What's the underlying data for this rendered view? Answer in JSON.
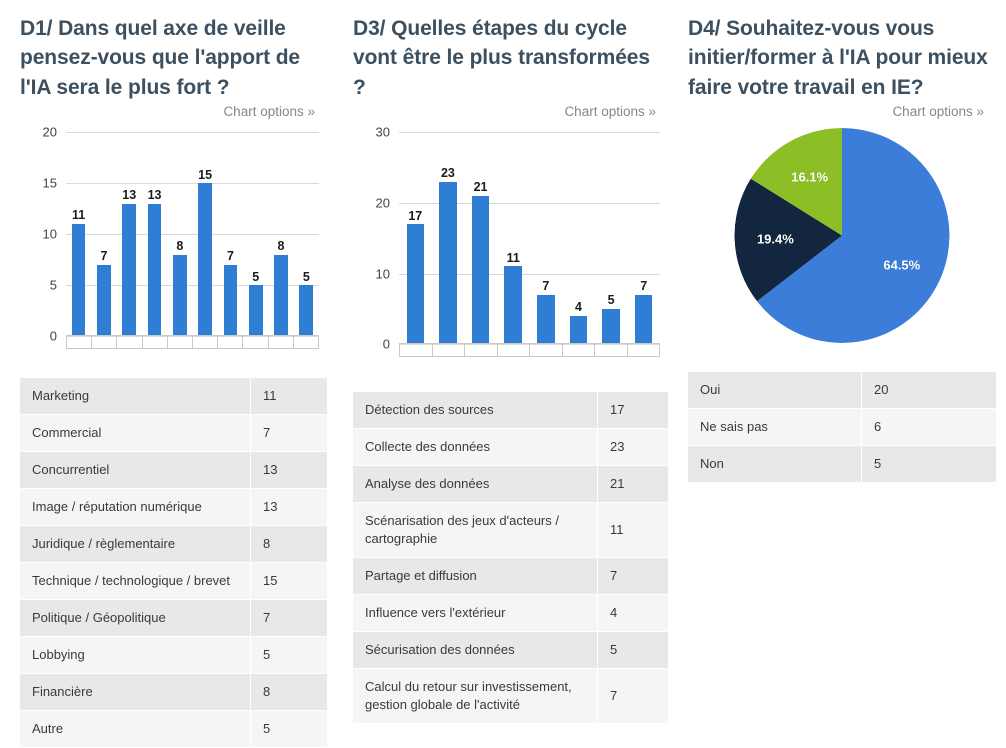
{
  "panels": [
    {
      "id": "d1",
      "title": "D1/ Dans quel axe de veille pensez-vous que l'apport de l'IA sera le plus fort ?",
      "chart_options_label": "Chart options »"
    },
    {
      "id": "d3",
      "title": "D3/ Quelles étapes du cycle vont être le plus transformées ?",
      "chart_options_label": "Chart options »"
    },
    {
      "id": "d4",
      "title": "D4/ Souhaitez-vous vous initier/former à l'IA pour mieux faire votre travail en IE?",
      "chart_options_label": "Chart options »"
    }
  ],
  "colors": {
    "bar_blue": "#2e7fd4",
    "pie_blue": "#3b7dd8",
    "pie_navy": "#12263f",
    "pie_green": "#8cbf26",
    "title": "#3d5060",
    "gridline": "#d9d9d9",
    "table_row_odd": "#e8e8e8",
    "table_row_even": "#f5f5f5"
  },
  "chart_data": [
    {
      "type": "bar",
      "id": "d1-chart",
      "title": "D1/ Dans quel axe de veille pensez-vous que l'apport de l'IA sera le plus fort ?",
      "xlabel": "",
      "ylabel": "",
      "ylim": [
        0,
        20
      ],
      "yticks": [
        0,
        5,
        10,
        15,
        20
      ],
      "grid": true,
      "legend": "none",
      "categories": [
        "Marketing",
        "Commercial",
        "Concurrentiel",
        "Image / réputation numérique",
        "Juridique / règlementaire",
        "Technique / technologique / brevet",
        "Politique / Géopolitique",
        "Lobbying",
        "Financière",
        "Autre"
      ],
      "values": [
        11,
        7,
        13,
        13,
        8,
        15,
        7,
        5,
        8,
        5
      ]
    },
    {
      "type": "bar",
      "id": "d3-chart",
      "title": "D3/ Quelles étapes du cycle vont être le plus transformées ?",
      "xlabel": "",
      "ylabel": "",
      "ylim": [
        0,
        30
      ],
      "yticks": [
        0,
        10,
        20,
        30
      ],
      "grid": true,
      "legend": "none",
      "categories": [
        "Détection des sources",
        "Collecte des données",
        "Analyse des données",
        "Scénarisation des jeux d'acteurs / cartographie",
        "Partage et diffusion",
        "Influence vers l'extérieur",
        "Sécurisation des données",
        "Calcul du retour sur investissement, gestion globale de l'activité"
      ],
      "values": [
        17,
        23,
        21,
        11,
        7,
        4,
        5,
        7
      ]
    },
    {
      "type": "pie",
      "id": "d4-chart",
      "title": "D4/ Souhaitez-vous vous initier/former à l'IA pour mieux faire votre travail en IE?",
      "legend": "none",
      "categories": [
        "Oui",
        "Ne sais pas",
        "Non"
      ],
      "values": [
        20,
        6,
        5
      ],
      "percent_labels": [
        "64.5%",
        "19.4%",
        "16.1%"
      ],
      "slice_colors": [
        "#3b7dd8",
        "#12263f",
        "#8cbf26"
      ]
    }
  ],
  "tables": {
    "d1": {
      "rows": [
        {
          "label": "Marketing",
          "value": "11"
        },
        {
          "label": "Commercial",
          "value": "7"
        },
        {
          "label": "Concurrentiel",
          "value": "13"
        },
        {
          "label": "Image / réputation numérique",
          "value": "13"
        },
        {
          "label": "Juridique / règlementaire",
          "value": "8"
        },
        {
          "label": "Technique / technologique / brevet",
          "value": "15"
        },
        {
          "label": "Politique / Géopolitique",
          "value": "7"
        },
        {
          "label": "Lobbying",
          "value": "5"
        },
        {
          "label": "Financière",
          "value": "8"
        },
        {
          "label": "Autre",
          "value": "5"
        }
      ]
    },
    "d3": {
      "rows": [
        {
          "label": "Détection des sources",
          "value": "17"
        },
        {
          "label": "Collecte des données",
          "value": "23"
        },
        {
          "label": "Analyse des données",
          "value": "21"
        },
        {
          "label": "Scénarisation des jeux d'acteurs / cartographie",
          "value": "11"
        },
        {
          "label": "Partage et diffusion",
          "value": "7"
        },
        {
          "label": "Influence vers l'extérieur",
          "value": "4"
        },
        {
          "label": "Sécurisation des données",
          "value": "5"
        },
        {
          "label": "Calcul du retour sur investissement, gestion globale de l'activité",
          "value": "7"
        }
      ]
    },
    "d4": {
      "rows": [
        {
          "label": "Oui",
          "value": "20"
        },
        {
          "label": "Ne sais pas",
          "value": "6"
        },
        {
          "label": "Non",
          "value": "5"
        }
      ]
    }
  }
}
